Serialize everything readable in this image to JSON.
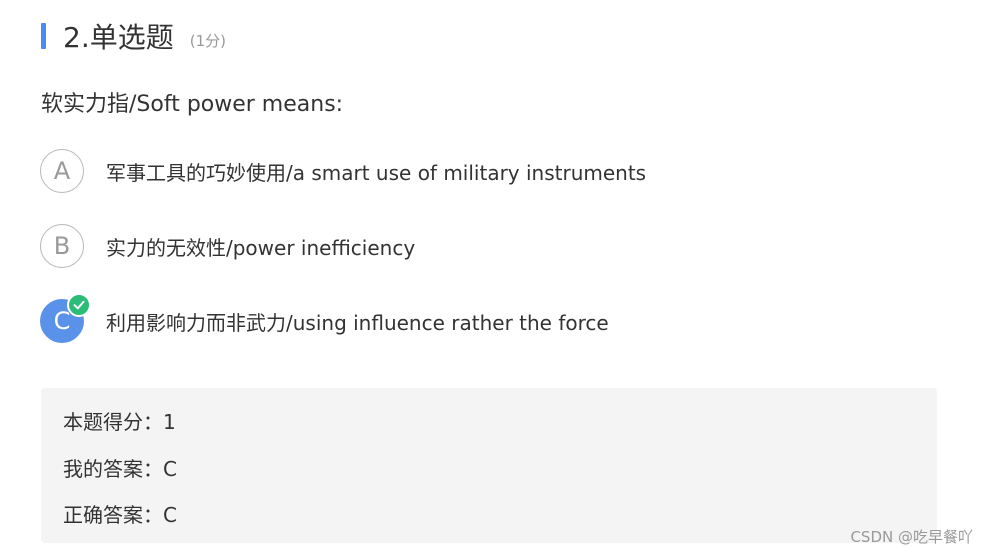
{
  "header": {
    "title": "2.单选题",
    "score": "(1分)",
    "accent_color": "#4a8af4"
  },
  "question": {
    "text": "软实力指/Soft power means:"
  },
  "options": [
    {
      "letter": "A",
      "text": "军事工具的巧妙使用/a smart use of military instruments",
      "selected": false
    },
    {
      "letter": "B",
      "text": "实力的无效性/power inefficiency",
      "selected": false
    },
    {
      "letter": "C",
      "text": "利用影响力而非武力/using influence rather the force",
      "selected": true,
      "correct": true,
      "badge_icon": "check-icon"
    }
  ],
  "result": {
    "score_line": "本题得分：1",
    "my_answer_line": "我的答案：C",
    "correct_answer_line": "正确答案：C"
  },
  "colors": {
    "selected_option": "#5b92e9",
    "correct_badge": "#2bbd78",
    "result_background": "#f4f4f4"
  },
  "watermark": "CSDN @吃早餐吖"
}
